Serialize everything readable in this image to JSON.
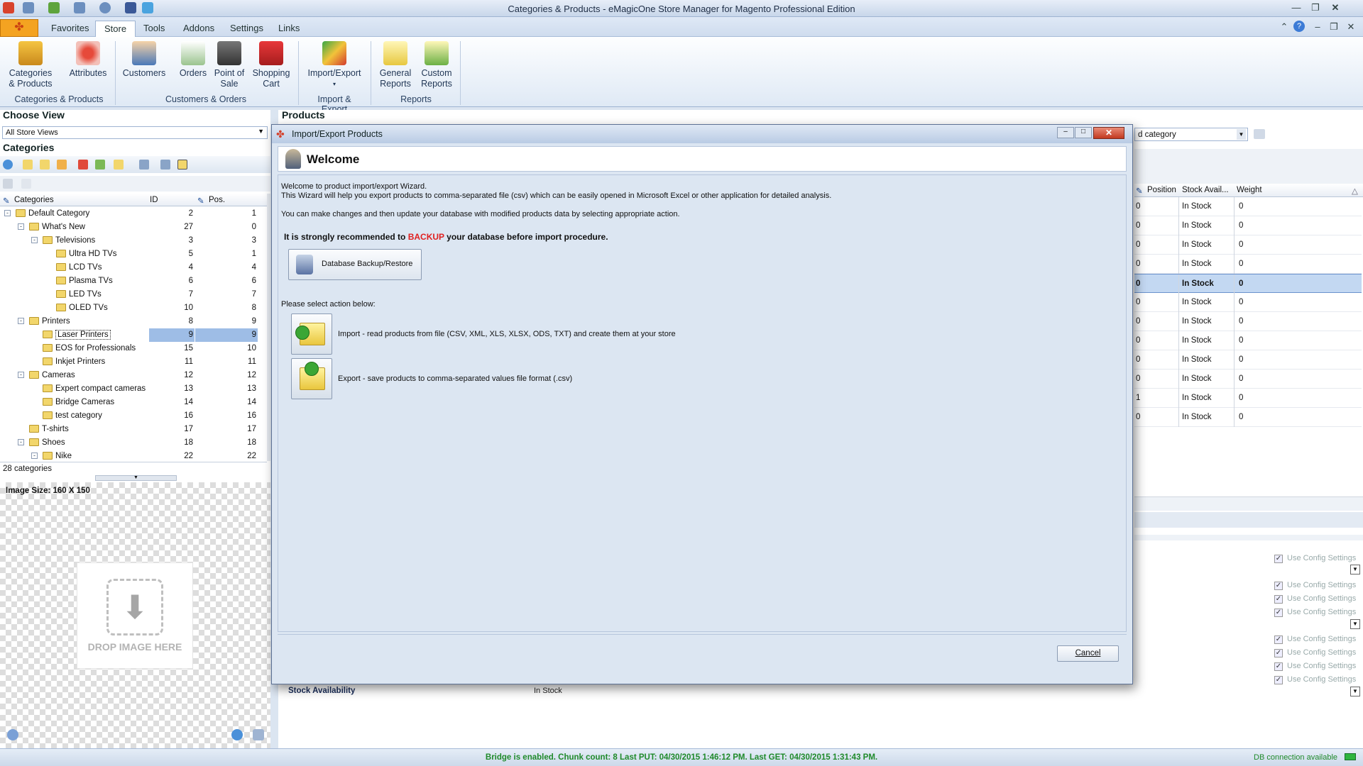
{
  "window": {
    "title": "Categories & Products - eMagicOne Store Manager for Magento Professional Edition"
  },
  "menu": {
    "app_icon": "✤",
    "tabs": [
      "Favorites",
      "Store",
      "Tools",
      "Addons",
      "Settings",
      "Links"
    ],
    "active_tab": "Store"
  },
  "ribbon": {
    "buttons": {
      "categories_products": "Categories & Products",
      "attributes": "Attributes",
      "customers": "Customers",
      "orders": "Orders",
      "point_of_sale": "Point of Sale",
      "shopping_cart": "Shopping Cart",
      "import_export": "Import/Export",
      "general_reports": "General Reports",
      "custom_reports": "Custom Reports"
    },
    "groups": {
      "categories_products": "Categories & Products",
      "customers_orders": "Customers & Orders",
      "import_export": "Import & Export",
      "reports": "Reports"
    }
  },
  "left": {
    "choose_view_title": "Choose View",
    "store_view": "All Store Views",
    "categories_title": "Categories",
    "columns": {
      "name": "Categories",
      "id": "ID",
      "pos": "Pos."
    },
    "tree": [
      {
        "name": "Default Category",
        "id": "2",
        "pos": "1",
        "level": 0,
        "exp": "-"
      },
      {
        "name": "What's New",
        "id": "27",
        "pos": "0",
        "level": 1,
        "exp": "-"
      },
      {
        "name": "Televisions",
        "id": "3",
        "pos": "3",
        "level": 2,
        "exp": "-"
      },
      {
        "name": "Ultra HD TVs",
        "id": "5",
        "pos": "1",
        "level": 3,
        "exp": ""
      },
      {
        "name": "LCD TVs",
        "id": "4",
        "pos": "4",
        "level": 3,
        "exp": ""
      },
      {
        "name": "Plasma TVs",
        "id": "6",
        "pos": "6",
        "level": 3,
        "exp": ""
      },
      {
        "name": "LED TVs",
        "id": "7",
        "pos": "7",
        "level": 3,
        "exp": ""
      },
      {
        "name": "OLED TVs",
        "id": "10",
        "pos": "8",
        "level": 3,
        "exp": ""
      },
      {
        "name": "Printers",
        "id": "8",
        "pos": "9",
        "level": 1,
        "exp": "-"
      },
      {
        "name": "Laser Printers",
        "id": "9",
        "pos": "9",
        "level": 2,
        "exp": "",
        "selected": true
      },
      {
        "name": "EOS for Professionals",
        "id": "15",
        "pos": "10",
        "level": 2,
        "exp": ""
      },
      {
        "name": "Inkjet Printers",
        "id": "11",
        "pos": "11",
        "level": 2,
        "exp": ""
      },
      {
        "name": "Cameras",
        "id": "12",
        "pos": "12",
        "level": 1,
        "exp": "-"
      },
      {
        "name": "Expert compact cameras",
        "id": "13",
        "pos": "13",
        "level": 2,
        "exp": ""
      },
      {
        "name": "Bridge Cameras",
        "id": "14",
        "pos": "14",
        "level": 2,
        "exp": ""
      },
      {
        "name": "test category",
        "id": "16",
        "pos": "16",
        "level": 2,
        "exp": ""
      },
      {
        "name": "T-shirts",
        "id": "17",
        "pos": "17",
        "level": 1,
        "exp": ""
      },
      {
        "name": "Shoes",
        "id": "18",
        "pos": "18",
        "level": 1,
        "exp": "-"
      },
      {
        "name": "Nike",
        "id": "22",
        "pos": "22",
        "level": 2,
        "exp": "-"
      }
    ],
    "count": "28 categories",
    "image_size": "Image Size: 160 X 150",
    "drop_text": "DROP IMAGE HERE"
  },
  "products": {
    "title": "Products",
    "filter_value": "d category",
    "columns": {
      "position": "Position",
      "stock": "Stock Avail...",
      "weight": "Weight"
    },
    "rows": [
      {
        "position": "0",
        "stock": "In Stock",
        "weight": "0"
      },
      {
        "position": "0",
        "stock": "In Stock",
        "weight": "0"
      },
      {
        "position": "0",
        "stock": "In Stock",
        "weight": "0"
      },
      {
        "position": "0",
        "stock": "In Stock",
        "weight": "0"
      },
      {
        "position": "0",
        "stock": "In Stock",
        "weight": "0",
        "selected": true
      },
      {
        "position": "0",
        "stock": "In Stock",
        "weight": "0"
      },
      {
        "position": "0",
        "stock": "In Stock",
        "weight": "0"
      },
      {
        "position": "0",
        "stock": "In Stock",
        "weight": "0"
      },
      {
        "position": "0",
        "stock": "In Stock",
        "weight": "0"
      },
      {
        "position": "0",
        "stock": "In Stock",
        "weight": "0"
      },
      {
        "position": "1",
        "stock": "In Stock",
        "weight": "0"
      },
      {
        "position": "0",
        "stock": "In Stock",
        "weight": "0"
      }
    ],
    "use_config": "Use Config Settings",
    "stock_availability_label": "Stock Availability",
    "stock_availability_value": "In Stock"
  },
  "dialog": {
    "title": "Import/Export Products",
    "heading": "Welcome",
    "intro1": "Welcome to product import/export Wizard.",
    "intro2": "This Wizard will help you export products to comma-separated file (csv) which can be easily opened in Microsoft Excel or other application for detailed analysis.",
    "intro3": "You can make changes and then update your database with modified products data by selecting appropriate action.",
    "warn_before": "It is strongly recommended to ",
    "warn_backup": "BACKUP",
    "warn_after": " your database before import procedure.",
    "backup_button": "Database Backup/Restore",
    "select_action": "Please select action below:",
    "import_text": "Import - read products from file (CSV, XML, XLS, XLSX, ODS, TXT) and create them at your store",
    "export_text": "Export - save products to comma-separated values file format (.csv)",
    "cancel": "Cancel"
  },
  "status": {
    "bridge": "Bridge is enabled. Chunk count: 8 Last PUT: 04/30/2015 1:46:12 PM. Last GET: 04/30/2015 1:31:43 PM.",
    "db": "DB connection available"
  }
}
